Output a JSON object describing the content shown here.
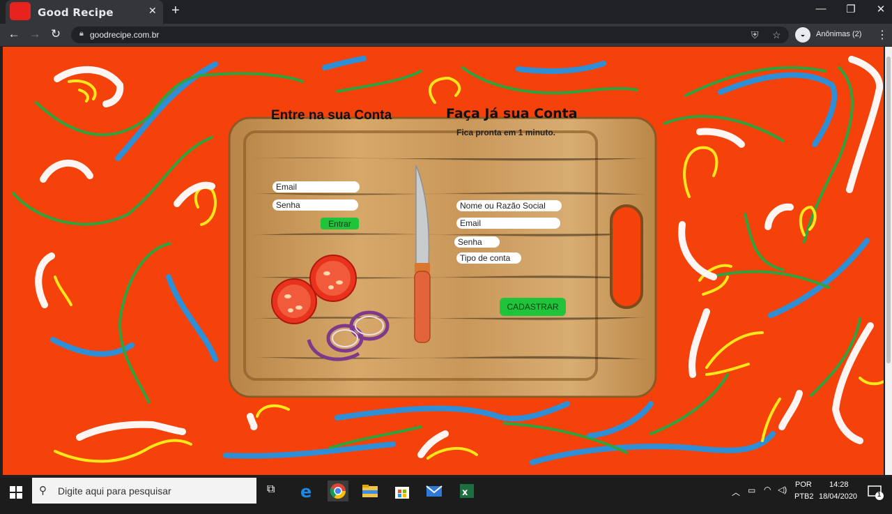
{
  "browser": {
    "tab_title": "Good Recipe",
    "tab_close": "✕",
    "new_tab": "+",
    "url": "goodrecipe.com.br",
    "profile_label": "Anônimas (2)",
    "favicon_color": "#e8231f"
  },
  "login": {
    "title": "Entre na sua Conta",
    "email_placeholder": "Email",
    "password_placeholder": "Senha",
    "submit_label": "Entrar"
  },
  "signup": {
    "title": "Faça Já sua Conta",
    "subtitle": "Fica pronta em 1 minuto.",
    "name_placeholder": "Nome ou Razão Social",
    "email_placeholder": "Email",
    "password_placeholder": "Senha",
    "type_placeholder": "Tipo de conta",
    "submit_label": "CADASTRAR"
  },
  "taskbar": {
    "search_placeholder": "Digite aqui para pesquisar",
    "language": "POR",
    "layout": "PTB2",
    "time": "14:28",
    "date": "18/04/2020",
    "notification_count": "1"
  },
  "colors": {
    "page_background": "#f5410a",
    "button_green": "#20c43a",
    "board_wood": "#c99a5b"
  },
  "icons": [
    "back-icon",
    "forward-icon",
    "reload-icon",
    "lock-icon",
    "shield-icon",
    "star-icon",
    "incognito-icon",
    "menu-icon",
    "windows-icon",
    "search-icon",
    "task-view-icon",
    "edge-icon",
    "chrome-icon",
    "explorer-icon",
    "store-icon",
    "mail-icon",
    "excel-icon"
  ]
}
